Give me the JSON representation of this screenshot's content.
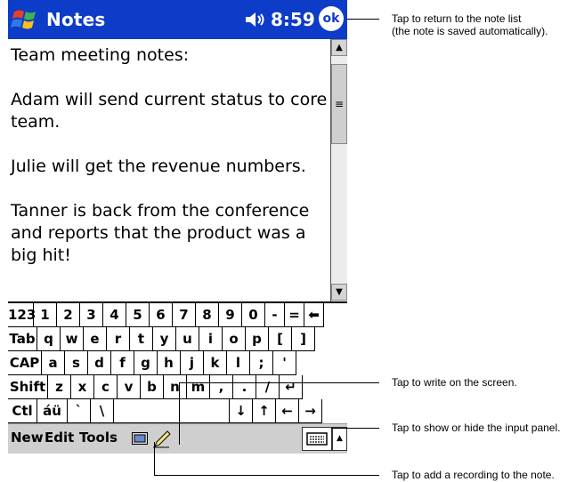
{
  "titlebar": {
    "app_title": "Notes",
    "time": "8:59",
    "ok_label": "ok",
    "logo_icon": "windows-flag-icon",
    "volume_icon": "speaker-icon"
  },
  "note": {
    "lines": [
      "Team meeting notes:",
      "",
      "Adam will send current status to core",
      "team.",
      "",
      "Julie will get the revenue numbers.",
      "",
      "Tanner is back from the conference",
      "and reports that the product was a",
      "big hit!"
    ]
  },
  "keyboard": {
    "rows": [
      [
        "123",
        "1",
        "2",
        "3",
        "4",
        "5",
        "6",
        "7",
        "8",
        "9",
        "0",
        "-",
        "=",
        "⬅"
      ],
      [
        "Tab",
        "q",
        "w",
        "e",
        "r",
        "t",
        "y",
        "u",
        "i",
        "o",
        "p",
        "[",
        "]"
      ],
      [
        "CAP",
        "a",
        "s",
        "d",
        "f",
        "g",
        "h",
        "j",
        "k",
        "l",
        ";",
        "'"
      ],
      [
        "Shift",
        "z",
        "x",
        "c",
        "v",
        "b",
        "n",
        "m",
        ",",
        ".",
        "/",
        "↵"
      ],
      [
        "Ctl",
        "áü",
        "`",
        "\\",
        "",
        "↓",
        "↑",
        "←",
        "→"
      ]
    ]
  },
  "cmdbar": {
    "menus": [
      "New",
      "Edit",
      "Tools"
    ],
    "keyboard_icon": "keyboard-icon",
    "pen_icon": "pen-icon",
    "input_panel_icon": "keyboard-icon"
  },
  "callouts": {
    "ok": "Tap to return to the note list\n(the note is saved automatically).",
    "pen": "Tap to write on the screen.",
    "input_panel": "Tap to show or hide the input panel.",
    "recording": "Tap to add a recording to the note."
  },
  "colors": {
    "titlebar": "#0d3cc8",
    "cmdbar": "#cfcfcf"
  }
}
